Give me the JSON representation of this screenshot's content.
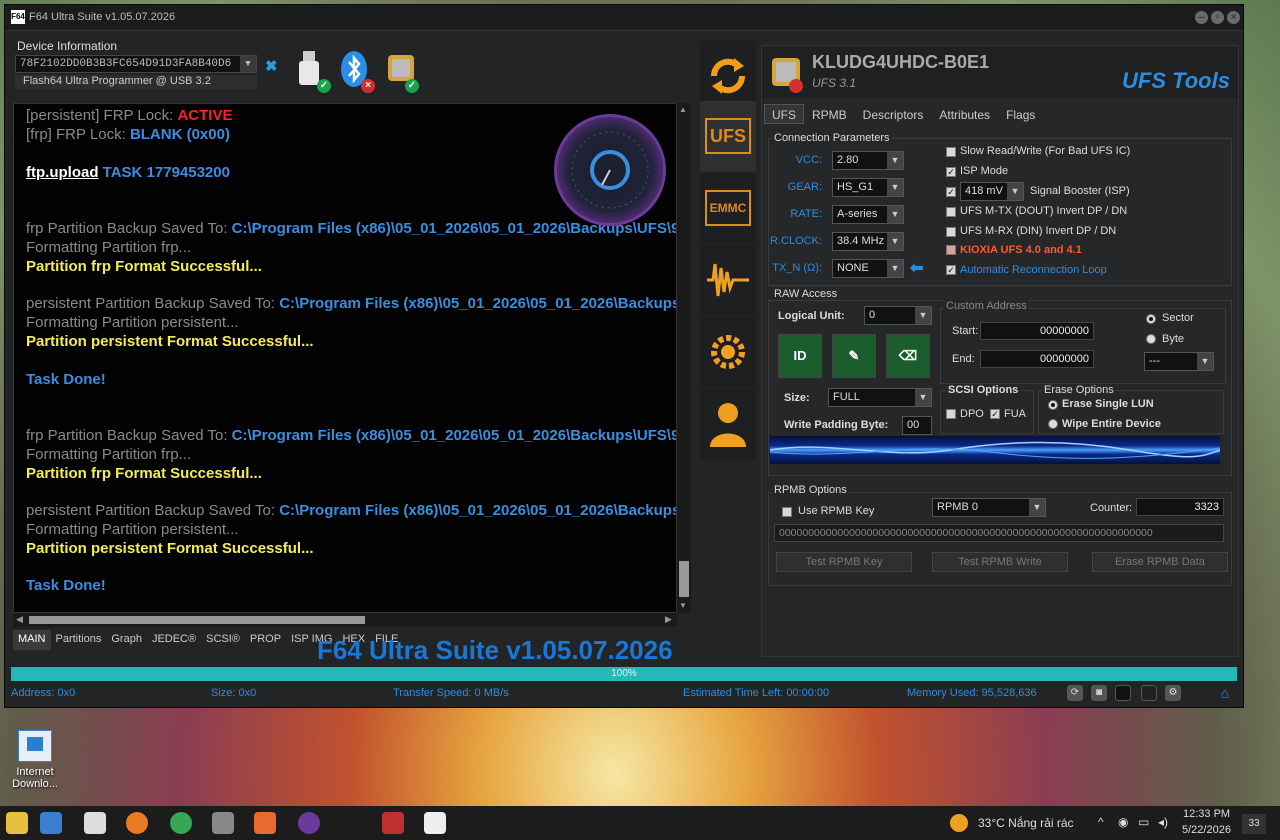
{
  "window": {
    "title": "F64 Ultra Suite v1.05.07.2026"
  },
  "device": {
    "label": "Device Information",
    "serial": "78F2102DD0B3B3FC654D91D3FA8B40D6",
    "port": "Flash64 Ultra Programmer @ USB 3.2"
  },
  "log": {
    "lines": [
      {
        "a": "[persistent] FRP Lock: ",
        "b": "ACTIVE"
      },
      {
        "a": "[frp] FRP Lock: ",
        "b": "BLANK (0x00)"
      },
      {
        "a": "ftp.upload",
        "b": " TASK 1779453200"
      },
      {
        "a": "frp Partition Backup Saved To: ",
        "b": "C:\\Program Files (x86)\\05_01_2026\\05_01_2026\\Backups\\UFS\\9"
      },
      {
        "a": "Formatting Partition frp..."
      },
      {
        "a": "Partition frp Format Successful..."
      },
      {
        "a": "persistent Partition Backup Saved To: ",
        "b": "C:\\Program Files (x86)\\05_01_2026\\05_01_2026\\Backups"
      },
      {
        "a": "Formatting Partition persistent..."
      },
      {
        "a": "Partition persistent Format Successful..."
      },
      {
        "a": "Task Done!"
      },
      {
        "a": "frp Partition Backup Saved To: ",
        "b": "C:\\Program Files (x86)\\05_01_2026\\05_01_2026\\Backups\\UFS\\9"
      },
      {
        "a": "Formatting Partition frp..."
      },
      {
        "a": "Partition frp Format Successful..."
      },
      {
        "a": "persistent Partition Backup Saved To: ",
        "b": "C:\\Program Files (x86)\\05_01_2026\\05_01_2026\\Backups"
      },
      {
        "a": "Formatting Partition persistent..."
      },
      {
        "a": "Partition persistent Format Successful..."
      },
      {
        "a": "Task Done!"
      }
    ]
  },
  "bottom_tabs": [
    "MAIN",
    "Partitions",
    "Graph",
    "JEDEC®",
    "SCSI®",
    "PROP",
    "ISP IMG",
    "HEX",
    "FILE"
  ],
  "banner": "F64 Ultra Suite v1.05.07.2026",
  "progress": {
    "text": "100%",
    "value": 1.0
  },
  "status": {
    "address": "Address: 0x0",
    "size": "Size: 0x0",
    "speed": "Transfer Speed: 0 MB/s",
    "eta": "Estimated Time Left: 00:00:00",
    "memory": "Memory Used: 95,528,636"
  },
  "sidebar": {
    "ufs": "UFS",
    "emmc": "EMMC"
  },
  "chip": {
    "name": "KLUDG4UHDC-B0E1",
    "version": "UFS 3.1",
    "tools": "UFS Tools"
  },
  "tabs": [
    "UFS",
    "RPMB",
    "Descriptors",
    "Attributes",
    "Flags"
  ],
  "conn": {
    "title": "Connection Parameters",
    "params": [
      {
        "label": "VCC:",
        "value": "2.80"
      },
      {
        "label": "GEAR:",
        "value": "HS_G1"
      },
      {
        "label": "RATE:",
        "value": "A-series"
      },
      {
        "label": "R.CLOCK:",
        "value": "38.4 MHz"
      },
      {
        "label": "TX_N (Ω):",
        "value": "NONE"
      }
    ],
    "opts": [
      {
        "label": "Slow Read/Write (For Bad UFS IC)",
        "checked": false
      },
      {
        "label": "ISP Mode",
        "checked": true
      },
      {
        "label": "Signal Booster (ISP)",
        "checked": true,
        "value": "418 mV"
      },
      {
        "label": "UFS M-TX (DOUT) Invert DP / DN",
        "checked": false
      },
      {
        "label": "UFS M-RX (DIN) Invert DP / DN",
        "checked": false
      },
      {
        "label": "KIOXIA UFS 4.0 and 4.1",
        "checked": false
      },
      {
        "label": "Automatic Reconnection Loop",
        "checked": true
      }
    ]
  },
  "raw": {
    "title": "RAW Access",
    "lu_label": "Logical Unit:",
    "lu": "0",
    "custom": "Custom Address",
    "start_label": "Start:",
    "start": "00000000",
    "end_label": "End:",
    "end": "00000000",
    "sector": "Sector",
    "byte": "Byte",
    "unit": "---",
    "size_label": "Size:",
    "size": "FULL",
    "pad_label": "Write Padding Byte:",
    "pad": "00",
    "scsi": "SCSI Options",
    "dpo": "DPO",
    "fua": "FUA",
    "erase": "Erase Options",
    "erase1": "Erase Single LUN",
    "erase2": "Wipe Entire Device"
  },
  "rpmb": {
    "title": "RPMB Options",
    "usekey": "Use RPMB Key",
    "sel": "RPMB 0",
    "counter_label": "Counter:",
    "counter": "3323",
    "key": "0000000000000000000000000000000000000000000000000000000000000000",
    "b1": "Test RPMB Key",
    "b2": "Test RPMB Write",
    "b3": "Erase RPMB Data"
  },
  "desktop": {
    "icon": "Internet Downlo..."
  },
  "taskbar": {
    "weather": "33°C  Nắng rải rác",
    "time": "12:33 PM",
    "date": "5/22/2026",
    "notif": "33"
  },
  "colors": {
    "accent": "#2b8ee0",
    "progress": "#25b8b8",
    "active": "#ff2222",
    "success": "#f4ec55"
  }
}
